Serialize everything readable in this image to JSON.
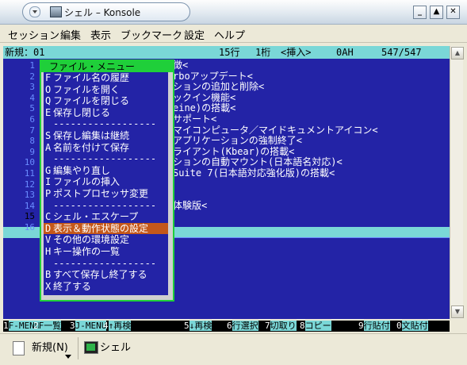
{
  "window": {
    "title": "シェル – Konsole",
    "buttons": {
      "minimize": "_",
      "maximize": "▲",
      "close": "✕"
    }
  },
  "menubar": [
    "セッション",
    "編集",
    "表示",
    "ブックマーク",
    "設定",
    "ヘルプ"
  ],
  "terminal": {
    "status": {
      "file": "新規：01",
      "line": "15行",
      "col": "1桁",
      "mode": "<挿入>",
      "code": "0AH",
      "pos": "547/547"
    },
    "line_numbers": [
      "1",
      "2",
      "3",
      "4",
      "5",
      "6",
      "7",
      "8",
      "9",
      "10",
      "11",
      "12",
      "13",
      "14",
      "15",
      "16"
    ],
    "line_texts": [
      "徴<",
      "rboアップデート<",
      "ションの追加と削除<",
      "ックイン機能<",
      "eine)の搭載<",
      " サポート<",
      "マイコンピュータ／マイドキュメントアイコン<",
      "アプリケーションの強制終了<",
      " ライアント(Kbear)の搭載<",
      "ションの自動マウント(日本語名対応)<",
      "Suite 7(日本語対応強化版)の搭載<",
      "",
      "",
      "体験版<",
      "",
      ""
    ],
    "menu": {
      "title": "ファイル・メニュー",
      "items": [
        {
          "key": "F",
          "label": "ファイル名の履歴"
        },
        {
          "key": "O",
          "label": "ファイルを開く"
        },
        {
          "key": "Q",
          "label": "ファイルを閉じる"
        },
        {
          "key": "E",
          "label": "保存し閉じる"
        },
        {
          "key": "",
          "label": "------------------"
        },
        {
          "key": "S",
          "label": "保存し編集は継続"
        },
        {
          "key": "A",
          "label": "名前を付けて保存"
        },
        {
          "key": "",
          "label": "------------------"
        },
        {
          "key": "G",
          "label": "編集やり直し"
        },
        {
          "key": "I",
          "label": "ファイルの挿入"
        },
        {
          "key": "P",
          "label": "ポストプロセッサ変更"
        },
        {
          "key": "",
          "label": "------------------"
        },
        {
          "key": "C",
          "label": "シェル・エスケープ"
        },
        {
          "key": "D",
          "label": "表示＆動作状態の設定"
        },
        {
          "key": "V",
          "label": "その他の環境設定"
        },
        {
          "key": "H",
          "label": "キー操作の一覧"
        },
        {
          "key": "",
          "label": "------------------"
        },
        {
          "key": "B",
          "label": "すべて保存し終了する"
        },
        {
          "key": "X",
          "label": "終了する"
        }
      ],
      "selected_index": 13
    }
  },
  "fkeys": [
    {
      "n": "1",
      "label": "F-MENU"
    },
    {
      "n": "2",
      "label": "F一覧"
    },
    {
      "n": "3",
      "label": "J-MENU"
    },
    {
      "n": "4",
      "label": "↑再検"
    },
    {
      "n": "5",
      "label": "↓再検"
    },
    {
      "n": "6",
      "label": "行選択"
    },
    {
      "n": "7",
      "label": "切取り"
    },
    {
      "n": "8",
      "label": "コピー"
    },
    {
      "n": "9",
      "label": "行貼付"
    },
    {
      "n": "0",
      "label": "文貼付"
    }
  ],
  "tabbar": {
    "new_label": "新規(N)",
    "tab_label": "シェル"
  },
  "colors": {
    "terminal_bg": "#2323a6",
    "status_bg": "#7ad7d7",
    "menu_border": "#1fcf3a",
    "selected_bg": "#c4581a",
    "line_marker": "#ff7070"
  }
}
